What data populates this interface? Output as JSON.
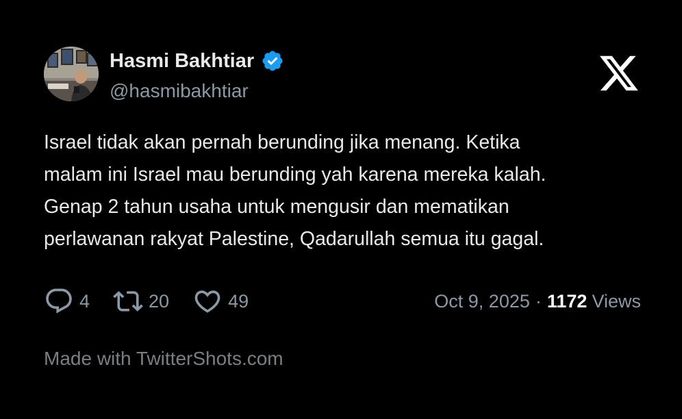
{
  "author": {
    "name": "Hasmi Bakhtiar",
    "handle": "@hasmibakhtiar",
    "verified": true,
    "verified_color": "#1d9bf0",
    "avatar_icon": "profile-photo"
  },
  "platform": {
    "logo_icon": "x-logo",
    "logo_color": "#ffffff"
  },
  "tweet": {
    "lines": [
      "Israel tidak akan pernah berunding jika menang. Ketika",
      "malam ini Israel mau berunding yah karena mereka kalah.",
      "Genap 2 tahun usaha untuk mengusir dan mematikan",
      "perlawanan rakyat Palestine, Qadarullah semua itu gagal."
    ]
  },
  "stats": {
    "replies": "4",
    "reposts": "20",
    "likes": "49",
    "reply_icon": "reply-icon",
    "repost_icon": "repost-icon",
    "like_icon": "heart-icon"
  },
  "meta": {
    "date": "Oct 9, 2025",
    "separator": "·",
    "views_count": "1172",
    "views_label": "Views"
  },
  "footer": {
    "text": "Made with TwitterShots.com"
  },
  "colors": {
    "background": "#000000",
    "primary_text": "#e7e9ea",
    "secondary_text": "#8b98a5"
  }
}
